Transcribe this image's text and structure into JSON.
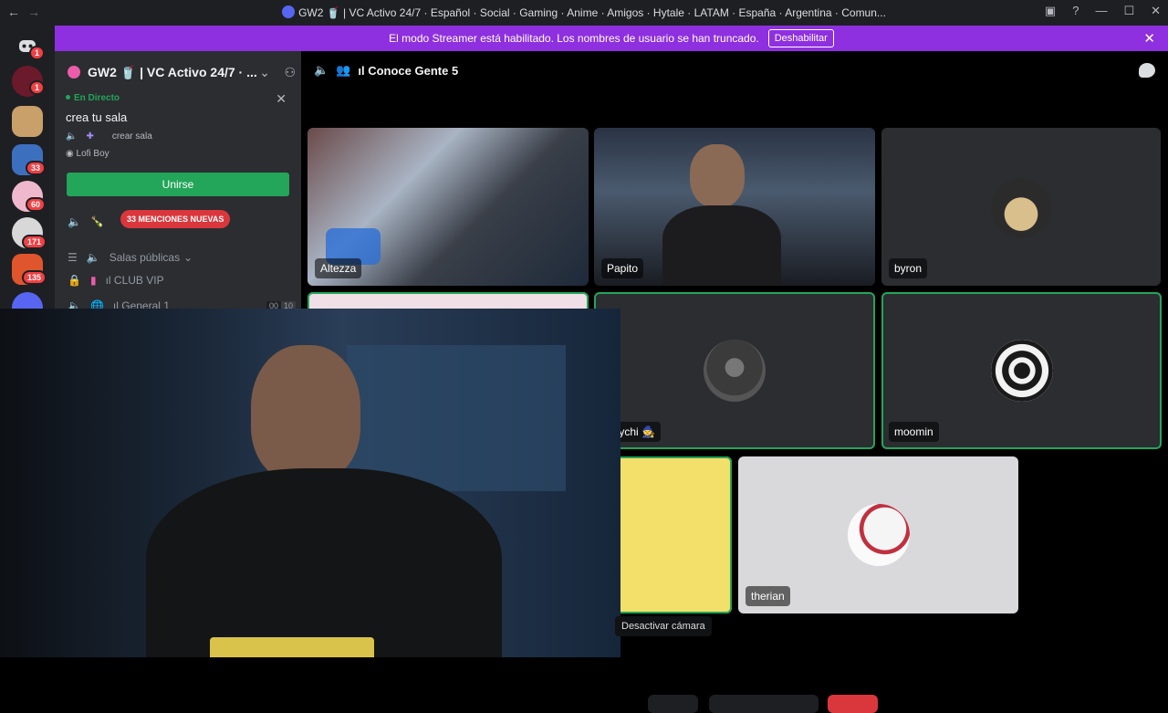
{
  "window": {
    "title": "GW2 🥤 | VC Activo 24/7 · Español · Social · Gaming · Anime · Amigos · Hytale · LATAM · España · Argentina · Comun..."
  },
  "banner": {
    "text": "El modo Streamer está habilitado. Los nombres de usuario se han truncado.",
    "button": "Deshabilitar"
  },
  "rail": {
    "badges": [
      "1",
      "1",
      "33",
      "60",
      "171",
      "135"
    ]
  },
  "sidebar": {
    "server_name": "GW2 🥤 | VC Activo 24/7 · ...",
    "live_label": "En Directo",
    "live_title": "crea tu sala",
    "live_channel": "crear sala",
    "live_user": "Lofi Boy",
    "join_button": "Unirse",
    "mentions_pill": "33 MENCIONES NUEVAS",
    "category": "Salas públicas",
    "channels": [
      {
        "name": "ıl CLUB VIP"
      },
      {
        "name": "ıl General 1",
        "count_a": "00",
        "count_b": "10"
      }
    ]
  },
  "voice": {
    "channel_title": "ıl Conoce Gente 5",
    "tiles": [
      {
        "name": "Altezza"
      },
      {
        "name": "Papito"
      },
      {
        "name": "byron"
      },
      {
        "name": "Luychi 🧙"
      },
      {
        "name": "moomin"
      },
      {
        "name": "therian"
      }
    ],
    "tooltip": "Desactivar cámara"
  },
  "colors": {
    "accent_green": "#23a55a",
    "banner_purple": "#8e30df",
    "mention_red": "#da373c"
  }
}
